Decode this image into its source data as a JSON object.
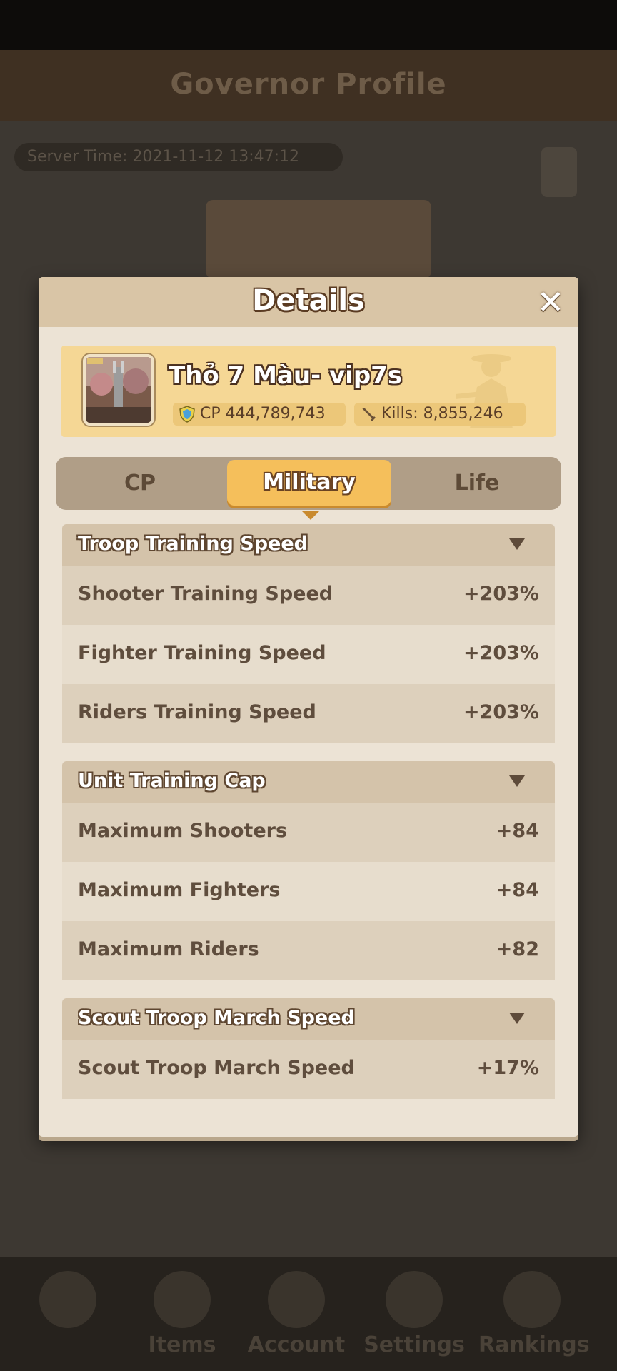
{
  "background": {
    "title": "Governor Profile",
    "server_time": "Server Time: 2021-11-12 13:47:12",
    "nav": [
      "Items",
      "Account",
      "Settings",
      "Rankings"
    ]
  },
  "dialog": {
    "title": "Details",
    "close_icon": "close-icon",
    "player": {
      "name": "Thỏ 7 Màu- vip7s",
      "cp_text": "CP 444,789,743",
      "kills_text": "Kills:  8,855,246"
    },
    "tabs": [
      {
        "label": "CP",
        "active": false
      },
      {
        "label": "Military",
        "active": true
      },
      {
        "label": "Life",
        "active": false
      }
    ],
    "sections": [
      {
        "title": "Troop Training Speed",
        "rows": [
          {
            "label": "Shooter Training Speed",
            "value": "+203%"
          },
          {
            "label": "Fighter Training Speed",
            "value": "+203%"
          },
          {
            "label": "Riders Training Speed",
            "value": "+203%"
          }
        ]
      },
      {
        "title": "Unit Training Cap",
        "rows": [
          {
            "label": "Maximum Shooters",
            "value": "+84"
          },
          {
            "label": "Maximum Fighters",
            "value": "+84"
          },
          {
            "label": "Maximum Riders",
            "value": "+82"
          }
        ]
      },
      {
        "title": "Scout Troop March Speed",
        "rows": [
          {
            "label": "Scout Troop March Speed",
            "value": "+17%"
          }
        ]
      }
    ]
  },
  "colors": {
    "accent_tab": "#f5bf5b",
    "player_card": "#f5d795",
    "dialog_bg": "#ece3d5"
  }
}
